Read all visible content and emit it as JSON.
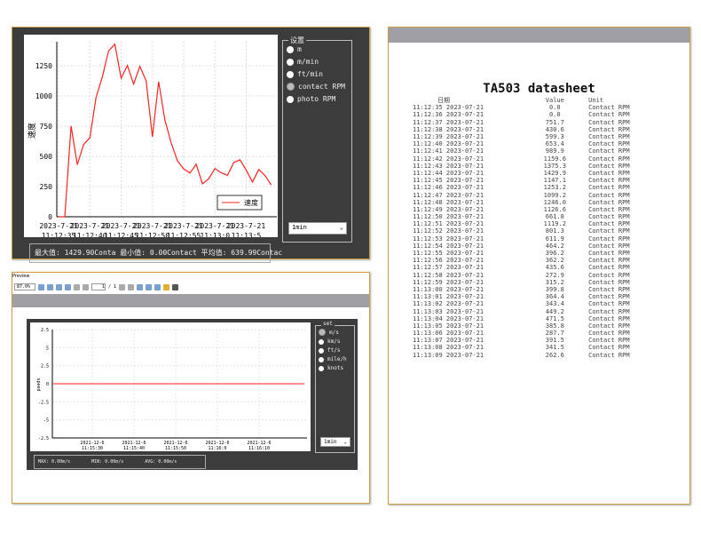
{
  "top_panel": {
    "ylabel": "速度",
    "legend": "速度",
    "group_title": "设置",
    "units": [
      {
        "label": "m",
        "selected": false
      },
      {
        "label": "m/min",
        "selected": false
      },
      {
        "label": "ft/min",
        "selected": false
      },
      {
        "label": "contact RPM",
        "selected": true
      },
      {
        "label": "photo RPM",
        "selected": false
      }
    ],
    "interval": "1min",
    "stats": "最大值: 1429.90Conta 最小值: 0.00Contact  平均值: 639.99Contac",
    "chart_data": {
      "type": "line",
      "ylim": [
        0,
        1450
      ],
      "yticks": [
        "0",
        "250",
        "500",
        "750",
        "1000",
        "1250"
      ],
      "xticks": [
        [
          "2023-7-21",
          "11:12:35"
        ],
        [
          "2023-7-21",
          "11:12:40"
        ],
        [
          "2023-7-21",
          "11:12:45"
        ],
        [
          "2023-7-21",
          "11:12:50"
        ],
        [
          "2023-7-21",
          "11:12:55"
        ],
        [
          "2023-7-21",
          "11:13:0"
        ],
        [
          "2023-7-21",
          "11:13:5"
        ]
      ],
      "series": [
        {
          "name": "速度",
          "color": "#ff2020",
          "values": [
            0.0,
            0.0,
            751.7,
            430.6,
            599.3,
            653.4,
            989.9,
            1159.6,
            1375.3,
            1429.9,
            1147.1,
            1253.2,
            1099.2,
            1246.0,
            1126.6,
            661.8,
            1119.2,
            801.3,
            611.9,
            464.2,
            396.2,
            362.2,
            435.6,
            272.9,
            315.2,
            399.8,
            364.4,
            343.4,
            449.2,
            471.5,
            385.8,
            287.7,
            391.5,
            341.5,
            262.6
          ]
        }
      ]
    }
  },
  "bottom_panel": {
    "window_title": "Preview",
    "zoom": "87.0%",
    "page": "1",
    "page_total": "/ 1",
    "ylabel": "speed",
    "group_title": "set",
    "units": [
      {
        "label": "m/s",
        "selected": true
      },
      {
        "label": "km/s",
        "selected": false
      },
      {
        "label": "ft/s",
        "selected": false
      },
      {
        "label": "mile/h",
        "selected": false
      },
      {
        "label": "knots",
        "selected": false
      }
    ],
    "interval": "1min",
    "max": "MAX:  0.00m/s",
    "min": "MIN:  0.00m/s",
    "avg": "AVG:  0.00m/s",
    "chart_data": {
      "type": "line",
      "yticks": [
        "2.5",
        "5",
        "2.5",
        "0",
        "-2.5",
        "-5",
        "-2.5"
      ],
      "xticks": [
        [
          "2021-12-6",
          "11:15:30"
        ],
        [
          "2021-12-6",
          "11:15:40"
        ],
        [
          "2021-12-6",
          "11:15:50"
        ],
        [
          "2021-12-6",
          "11:16:0"
        ],
        [
          "2021-12-6",
          "11:16:10"
        ]
      ],
      "series": [
        {
          "color": "#ff2020",
          "values": [
            0,
            0
          ]
        }
      ]
    }
  },
  "datasheet": {
    "title": "TA503 datasheet",
    "headers": [
      "日期",
      "Value",
      "Unit"
    ],
    "rows": [
      [
        "11:12:35 2023-07-21",
        "0.0",
        "Contact RPM"
      ],
      [
        "11:12:36 2023-07-21",
        "0.0",
        "Contact RPM"
      ],
      [
        "11:12:37 2023-07-21",
        "751.7",
        "Contact RPM"
      ],
      [
        "11:12:38 2023-07-21",
        "430.6",
        "Contact RPM"
      ],
      [
        "11:12:39 2023-07-21",
        "599.3",
        "Contact RPM"
      ],
      [
        "11:12:40 2023-07-21",
        "653.4",
        "Contact RPM"
      ],
      [
        "11:12:41 2023-07-21",
        "989.9",
        "Contact RPM"
      ],
      [
        "11:12:42 2023-07-21",
        "1159.6",
        "Contact RPM"
      ],
      [
        "11:12:43 2023-07-21",
        "1375.3",
        "Contact RPM"
      ],
      [
        "11:12:44 2023-07-21",
        "1429.9",
        "Contact RPM"
      ],
      [
        "11:12:45 2023-07-21",
        "1147.1",
        "Contact RPM"
      ],
      [
        "11:12:46 2023-07-21",
        "1253.2",
        "Contact RPM"
      ],
      [
        "11:12:47 2023-07-21",
        "1099.2",
        "Contact RPM"
      ],
      [
        "11:12:48 2023-07-21",
        "1246.0",
        "Contact RPM"
      ],
      [
        "11:12:49 2023-07-21",
        "1126.6",
        "Contact RPM"
      ],
      [
        "11:12:50 2023-07-21",
        "661.8",
        "Contact RPM"
      ],
      [
        "11:12:51 2023-07-21",
        "1119.2",
        "Contact RPM"
      ],
      [
        "11:12:52 2023-07-21",
        "801.3",
        "Contact RPM"
      ],
      [
        "11:12:53 2023-07-21",
        "611.9",
        "Contact RPM"
      ],
      [
        "11:12:54 2023-07-21",
        "464.2",
        "Contact RPM"
      ],
      [
        "11:12:55 2023-07-21",
        "396.2",
        "Contact RPM"
      ],
      [
        "11:12:56 2023-07-21",
        "362.2",
        "Contact RPM"
      ],
      [
        "11:12:57 2023-07-21",
        "435.6",
        "Contact RPM"
      ],
      [
        "11:12:58 2023-07-21",
        "272.9",
        "Contact RPM"
      ],
      [
        "11:12:59 2023-07-21",
        "315.2",
        "Contact RPM"
      ],
      [
        "11:13:00 2023-07-21",
        "399.8",
        "Contact RPM"
      ],
      [
        "11:13:01 2023-07-21",
        "364.4",
        "Contact RPM"
      ],
      [
        "11:13:02 2023-07-21",
        "343.4",
        "Contact RPM"
      ],
      [
        "11:13:03 2023-07-21",
        "449.2",
        "Contact RPM"
      ],
      [
        "11:13:04 2023-07-21",
        "471.5",
        "Contact RPM"
      ],
      [
        "11:13:05 2023-07-21",
        "385.8",
        "Contact RPM"
      ],
      [
        "11:13:06 2023-07-21",
        "287.7",
        "Contact RPM"
      ],
      [
        "11:13:07 2023-07-21",
        "391.5",
        "Contact RPM"
      ],
      [
        "11:13:08 2023-07-21",
        "341.5",
        "Contact RPM"
      ],
      [
        "11:13:09 2023-07-21",
        "262.6",
        "Contact RPM"
      ]
    ]
  }
}
